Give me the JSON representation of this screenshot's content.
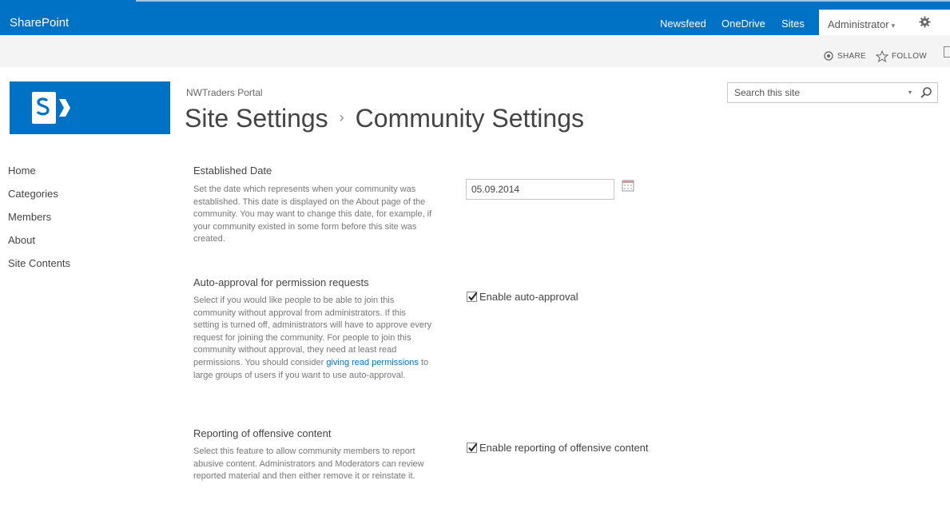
{
  "topbar": {
    "brand": "SharePoint",
    "nav": [
      "Newsfeed",
      "OneDrive",
      "Sites"
    ],
    "user": "Administrator",
    "user_caret": "▾",
    "accent_color": "#0072c6"
  },
  "actions": {
    "share": "SHARE",
    "follow": "FOLLOW"
  },
  "header": {
    "site_name": "NWTraders Portal",
    "title_parent": "Site Settings",
    "title_separator": "›",
    "title_current": "Community Settings",
    "search_placeholder": "Search this site",
    "search_caret": "▾"
  },
  "leftnav": {
    "items": [
      "Home",
      "Categories",
      "Members",
      "About",
      "Site Contents"
    ]
  },
  "sections": {
    "established": {
      "title": "Established Date",
      "description": "Set the date which represents when your community was established. This date is displayed on the About page of the community. You may want to change this date, for example, if your community existed in some form before this site was created.",
      "date_value": "05.09.2014"
    },
    "auto_approval": {
      "title": "Auto-approval for permission requests",
      "description_before": "Select if you would like people to be able to join this community without approval from administrators. If this setting is turned off, administrators will have to approve every request for joining the community. For people to join this community without approval, they need at least read permissions. You should consider ",
      "link_text": "giving read permissions",
      "description_after": " to large groups of users if you want to use auto-approval.",
      "checkbox_label": "Enable auto-approval",
      "checked": true
    },
    "offensive": {
      "title": "Reporting of offensive content",
      "description": "Select this feature to allow community members to report abusive content. Administrators and Moderators can review reported material and then either remove it or reinstate it.",
      "checkbox_label": "Enable reporting of offensive content",
      "checked": true
    }
  }
}
